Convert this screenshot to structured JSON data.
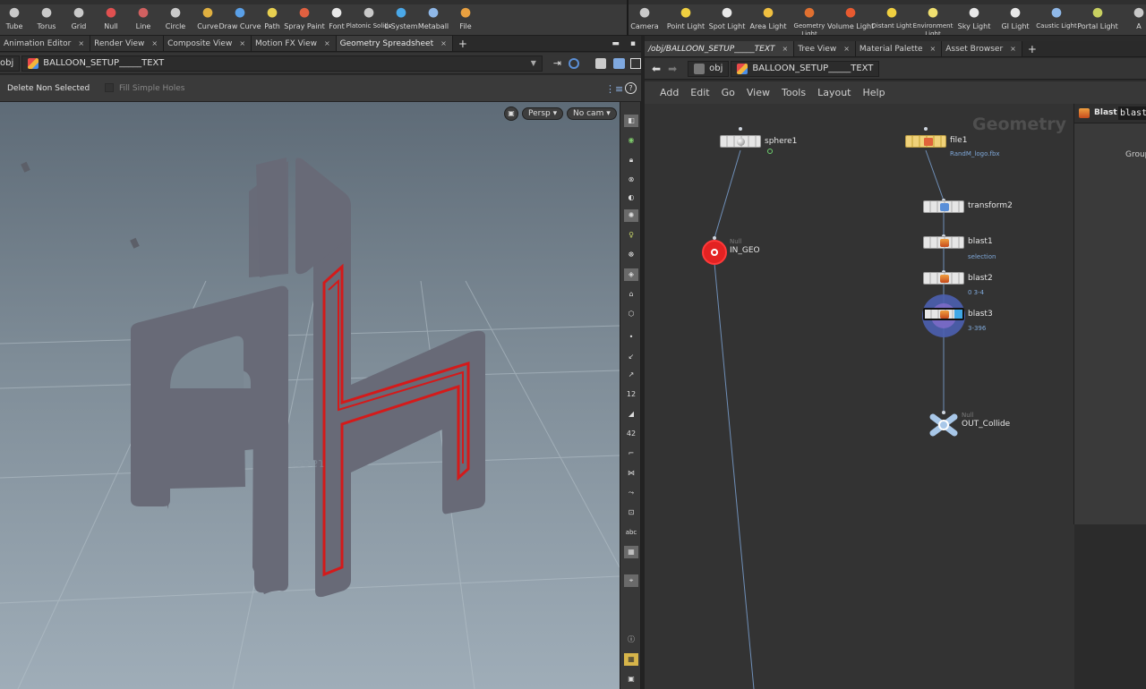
{
  "shelf_left": {
    "tools": [
      {
        "label": "Tube",
        "icon": "tube-icon"
      },
      {
        "label": "Torus",
        "icon": "torus-icon"
      },
      {
        "label": "Grid",
        "icon": "grid-icon"
      },
      {
        "label": "Null",
        "icon": "null-icon"
      },
      {
        "label": "Line",
        "icon": "line-icon"
      },
      {
        "label": "Circle",
        "icon": "circle-icon"
      },
      {
        "label": "Curve",
        "icon": "curve-icon"
      },
      {
        "label": "Draw Curve",
        "icon": "draw-curve-icon"
      },
      {
        "label": "Path",
        "icon": "path-icon"
      },
      {
        "label": "Spray Paint",
        "icon": "spray-paint-icon"
      },
      {
        "label": "Font",
        "icon": "font-icon"
      },
      {
        "label": "Platonic Solids",
        "icon": "platonic-solids-icon"
      },
      {
        "label": "L-System",
        "icon": "l-system-icon"
      },
      {
        "label": "Metaball",
        "icon": "metaball-icon"
      },
      {
        "label": "File",
        "icon": "file-icon"
      }
    ]
  },
  "shelf_right": {
    "tools": [
      {
        "label": "Camera",
        "icon": "camera-icon"
      },
      {
        "label": "Point Light",
        "icon": "point-light-icon"
      },
      {
        "label": "Spot Light",
        "icon": "spot-light-icon"
      },
      {
        "label": "Area Light",
        "icon": "area-light-icon"
      },
      {
        "label": "Geometry Light",
        "icon": "geometry-light-icon"
      },
      {
        "label": "Volume Light",
        "icon": "volume-light-icon"
      },
      {
        "label": "Distant Light",
        "icon": "distant-light-icon"
      },
      {
        "label": "Environment Light",
        "icon": "environment-light-icon"
      },
      {
        "label": "Sky Light",
        "icon": "sky-light-icon"
      },
      {
        "label": "GI Light",
        "icon": "gi-light-icon"
      },
      {
        "label": "Caustic Light",
        "icon": "caustic-light-icon"
      },
      {
        "label": "Portal Light",
        "icon": "portal-light-icon"
      },
      {
        "label": "A",
        "icon": "ambient-light-icon"
      }
    ]
  },
  "left_tabs": [
    "Animation Editor",
    "Render View",
    "Composite View",
    "Motion FX View",
    "Geometry Spreadsheet"
  ],
  "left_path": {
    "root": "obj",
    "node": "BALLOON_SETUP_____TEXT"
  },
  "operation_bar": {
    "delete_non_selected": "Delete Non Selected",
    "fill_simple_holes": "Fill Simple Holes"
  },
  "viewport": {
    "camera_mode": "Persp",
    "camera": "No cam"
  },
  "vtools": {
    "abc": "abc",
    "num12": "12",
    "num42": "42"
  },
  "right_tabs": [
    "/obj/BALLOON_SETUP_____TEXT",
    "Tree View",
    "Material Palette",
    "Asset Browser"
  ],
  "right_path": {
    "root": "obj",
    "node": "BALLOON_SETUP_____TEXT"
  },
  "menu": [
    "Add",
    "Edit",
    "Go",
    "View",
    "Tools",
    "Layout",
    "Help"
  ],
  "network": {
    "context_label": "Geometry",
    "nodes": {
      "sphere1": {
        "name": "sphere1"
      },
      "in_geo": {
        "type": "Null",
        "name": "IN_GEO"
      },
      "file1": {
        "name": "file1",
        "sub": "RandM_logo.fbx"
      },
      "transform2": {
        "name": "transform2"
      },
      "blast1": {
        "name": "blast1",
        "sub": "selection"
      },
      "blast2": {
        "name": "blast2",
        "sub": "0 3-4"
      },
      "blast3": {
        "name": "blast3",
        "sub": "3-396"
      },
      "out_collide": {
        "type": "Null",
        "name": "OUT_Collide"
      }
    }
  },
  "params": {
    "title": "Blast",
    "name_field": "blast",
    "group_label": "Group"
  }
}
